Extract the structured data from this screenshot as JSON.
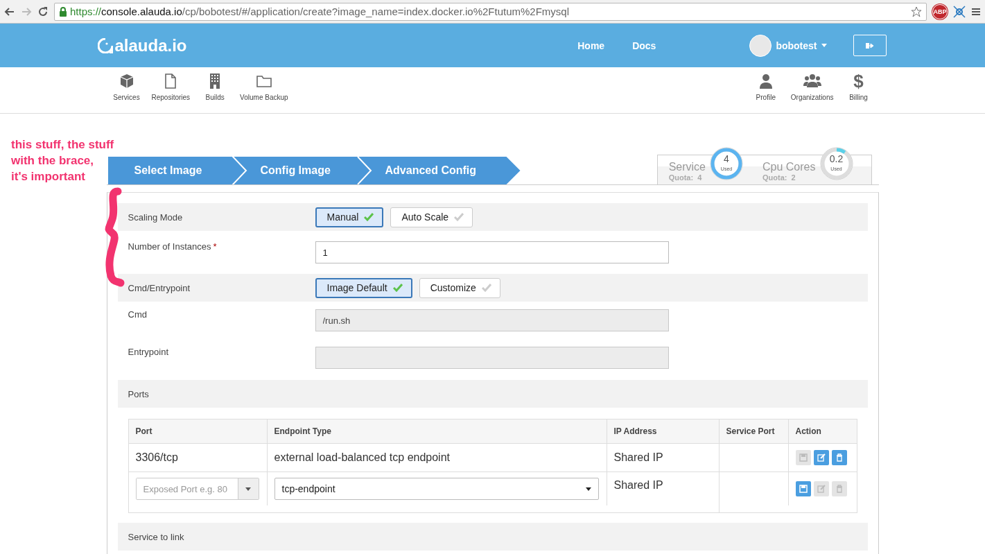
{
  "browser": {
    "url_parts": [
      {
        "kind": "scheme",
        "text": "https://"
      },
      {
        "kind": "host",
        "text": "console.alauda.io"
      },
      {
        "kind": "path",
        "text": "/cp/bobotest/#/application/create?image_name=index.docker.io%2Ftutum%2Fmysql"
      }
    ],
    "extension_badge": "ABP"
  },
  "header": {
    "logo": "alauda.io",
    "links": [
      "Home",
      "Docs"
    ],
    "user": "bobotest"
  },
  "nav": {
    "left": [
      {
        "label": "Services"
      },
      {
        "label": "Repositories"
      },
      {
        "label": "Builds"
      },
      {
        "label": "Volume Backup"
      }
    ],
    "right": [
      {
        "label": "Profile"
      },
      {
        "label": "Organizations"
      },
      {
        "label": "Billing",
        "glyph": "$"
      }
    ]
  },
  "wizard": {
    "steps": [
      "Select Image",
      "Config Image",
      "Advanced Config"
    ]
  },
  "quotas": [
    {
      "name": "Service",
      "quota": "Quota:  4",
      "value": "4",
      "unit": "Used",
      "level": 1,
      "color": "#5bb4f0"
    },
    {
      "name": "Cpu Cores",
      "quota": "Quota:  2",
      "value": "0.2",
      "unit": "Used",
      "level": 0.1,
      "color": "#5bd0e8"
    }
  ],
  "form": {
    "rows": [
      {
        "kind": "toggle",
        "label": "Scaling Mode",
        "options": [
          {
            "label": "Manual",
            "selected": true
          },
          {
            "label": "Auto Scale",
            "selected": false
          }
        ]
      },
      {
        "kind": "input",
        "label": "Number of Instances",
        "required_mark": "*",
        "value": "1"
      },
      {
        "kind": "toggle",
        "label": "Cmd/Entrypoint",
        "options": [
          {
            "label": "Image Default",
            "selected": true
          },
          {
            "label": "Customize",
            "selected": false
          }
        ]
      },
      {
        "kind": "readonly",
        "label": "Cmd",
        "value": "/run.sh"
      },
      {
        "kind": "readonly",
        "label": "Entrypoint"
      },
      {
        "kind": "section",
        "label": "Ports"
      },
      {
        "kind": "ports_table",
        "columns": [
          "Port",
          "Endpoint Type",
          "IP Address",
          "Service Port",
          "Action"
        ],
        "rows": [
          {
            "kind": "static",
            "port": "3306/tcp",
            "endpoint_type": "external load-balanced tcp endpoint",
            "ip_address": "Shared IP",
            "actions": [
              {
                "disabled": true
              },
              {
                "disabled": false
              },
              {
                "disabled": false
              }
            ]
          },
          {
            "kind": "edit",
            "port_placeholder": "Exposed Port e.g. 80",
            "endpoint_type": "tcp-endpoint",
            "ip_address": "Shared IP",
            "actions": [
              {
                "disabled": false
              },
              {
                "disabled": true
              },
              {
                "disabled": true
              }
            ]
          }
        ]
      },
      {
        "kind": "section",
        "label": "Service to link"
      }
    ]
  },
  "annotation": {
    "lines": [
      "this stuff, the stuff",
      "with the brace,",
      "it's important"
    ]
  }
}
